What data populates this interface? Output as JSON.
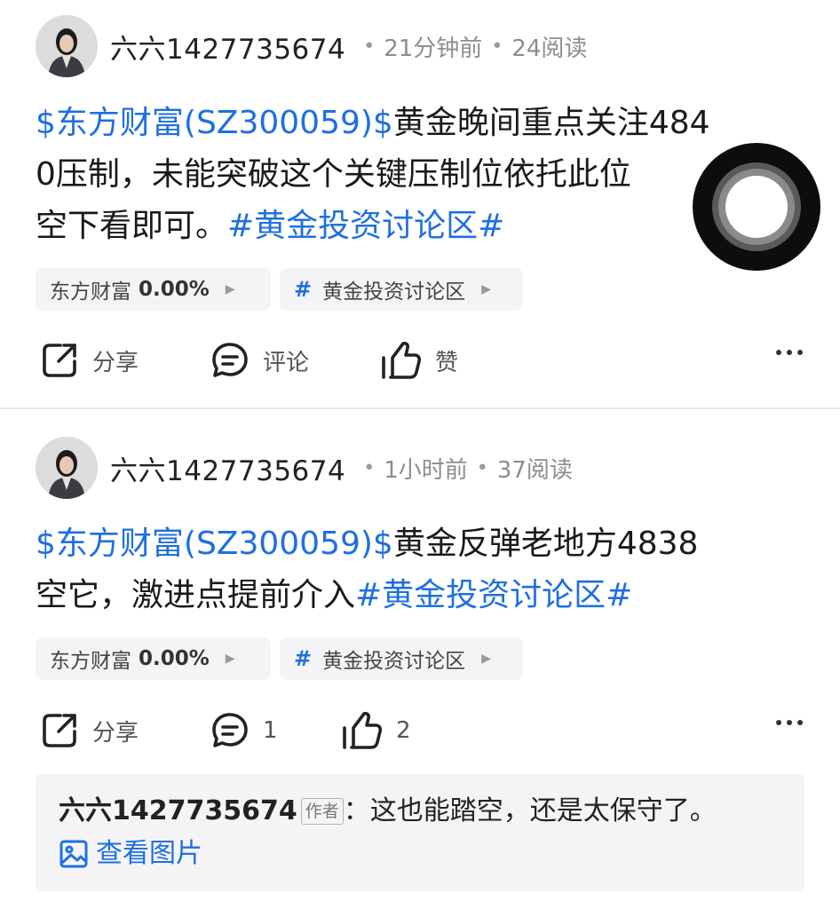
{
  "posts": [
    {
      "author": "六六1427735674",
      "time": "21分钟前",
      "reads": "24阅读",
      "content": {
        "stock_tag": "$东方财富(SZ300059)$",
        "line1_rest": "黄金晚间重点关注484",
        "line2": "0压制，未能突破这个关键压制位依托此位",
        "line3": "空下看即可。",
        "topic_tag": "#黄金投资讨论区#"
      },
      "chips": {
        "stock_name": "东方财富",
        "stock_change": "0.00%",
        "topic": "黄金投资讨论区"
      },
      "actions": {
        "share": "分享",
        "comment": "评论",
        "like": "赞"
      }
    },
    {
      "author": "六六1427735674",
      "time": "1小时前",
      "reads": "37阅读",
      "content": {
        "stock_tag": "$东方财富(SZ300059)$",
        "line1_rest": "黄金反弹老地方4838",
        "line2": "空它，激进点提前介入",
        "topic_tag": "#黄金投资讨论区#"
      },
      "chips": {
        "stock_name": "东方财富",
        "stock_change": "0.00%",
        "topic": "黄金投资讨论区"
      },
      "actions": {
        "share": "分享",
        "comment": "1",
        "like": "2"
      },
      "top_comment": {
        "author": "六六1427735674",
        "badge": "作者",
        "separator": "：",
        "text": "这也能踏空，还是太保守了。",
        "view_image": "查看图片"
      }
    }
  ],
  "colors": {
    "link_blue": "#1f6fe0",
    "chip_bg": "#f4f4f6",
    "meta_gray": "#8d8d8d"
  },
  "icons": [
    "share-icon",
    "comment-icon",
    "like-icon",
    "more-icon",
    "image-icon",
    "floating-assist-button"
  ]
}
